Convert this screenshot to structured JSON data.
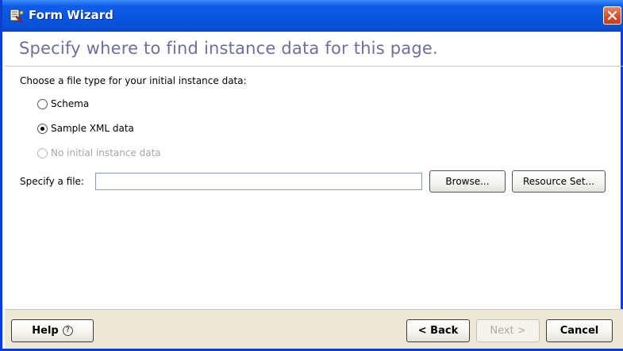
{
  "window": {
    "title": "Form Wizard",
    "icon": "form-wizard-app-icon",
    "close_icon": "close-icon"
  },
  "page": {
    "heading": "Specify where to find instance data for this page.",
    "prompt": "Choose a file type for your initial instance data:"
  },
  "options": [
    {
      "label": "Schema",
      "selected": false,
      "enabled": true
    },
    {
      "label": "Sample XML data",
      "selected": true,
      "enabled": true
    },
    {
      "label": "No initial instance data",
      "selected": false,
      "enabled": false
    }
  ],
  "file": {
    "label": "Specify a file:",
    "value": "",
    "browse_label": "Browse...",
    "resource_set_label": "Resource Set..."
  },
  "footer": {
    "help_label": "Help",
    "help_icon_glyph": "?",
    "back_label": "< Back",
    "next_label": "Next >",
    "next_enabled": false,
    "cancel_label": "Cancel"
  },
  "colors": {
    "titlebar": "#0a55e0",
    "heading": "#6f6f9a",
    "close_button": "#d9532f",
    "footer_bg": "#ece9d8"
  }
}
